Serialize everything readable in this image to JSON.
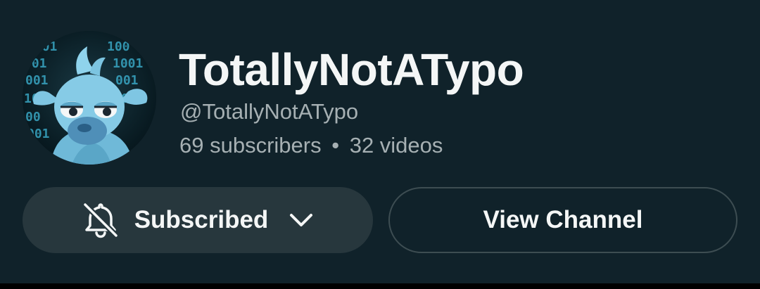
{
  "channel": {
    "name": "TotallyNotATypo",
    "handle": "@TotallyNotATypo",
    "subscribers": "69 subscribers",
    "separator": "•",
    "videos": "32 videos",
    "avatar_icon": "cartoon-goat-avatar"
  },
  "actions": {
    "subscribed_label": "Subscribed",
    "subscribed_icon": "bell-off-icon",
    "dropdown_icon": "chevron-down-icon",
    "view_channel_label": "View Channel"
  },
  "colors": {
    "background": "#10222a",
    "button_fill": "#27373d",
    "button_border": "#3d4d52",
    "primary_text": "#f4f6f6",
    "secondary_text": "#a6b0b3"
  }
}
